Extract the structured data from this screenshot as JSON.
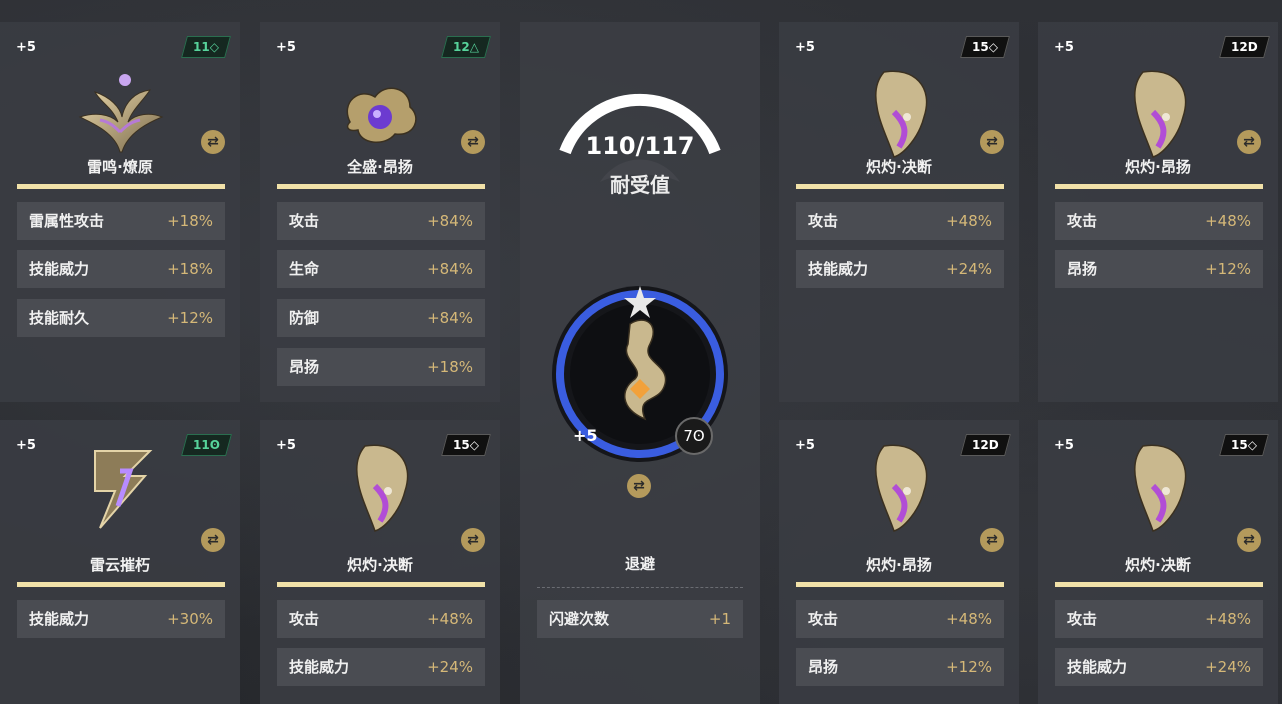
{
  "left_cards": [
    {
      "plus": "+5",
      "badge": "11◇",
      "badge_style": "green",
      "name": "雷鸣·燎原",
      "stats": [
        {
          "k": "雷属性攻击",
          "v": "+18%"
        },
        {
          "k": "技能威力",
          "v": "+18%"
        },
        {
          "k": "技能耐久",
          "v": "+12%"
        }
      ],
      "icon": "phoenix-emblem-icon"
    },
    {
      "plus": "+5",
      "badge": "12△",
      "badge_style": "green",
      "name": "全盛·昂扬",
      "stats": [
        {
          "k": "攻击",
          "v": "+84%"
        },
        {
          "k": "生命",
          "v": "+84%"
        },
        {
          "k": "防御",
          "v": "+84%"
        },
        {
          "k": "昂扬",
          "v": "+18%"
        }
      ],
      "icon": "serpent-orb-emblem-icon"
    },
    {
      "plus": "+5",
      "badge": "11ʘ",
      "badge_style": "green",
      "name": "雷云摧朽",
      "stats": [
        {
          "k": "技能威力",
          "v": "+30%"
        }
      ],
      "icon": "lightning-emblem-icon"
    },
    {
      "plus": "+5",
      "badge": "15◇",
      "badge_style": "black",
      "name": "炽灼·决断",
      "stats": [
        {
          "k": "攻击",
          "v": "+48%"
        },
        {
          "k": "技能威力",
          "v": "+24%"
        }
      ],
      "icon": "mask-emblem-icon"
    }
  ],
  "right_cards": [
    {
      "plus": "+5",
      "badge": "15◇",
      "badge_style": "black",
      "name": "炽灼·决断",
      "stats": [
        {
          "k": "攻击",
          "v": "+48%"
        },
        {
          "k": "技能威力",
          "v": "+24%"
        }
      ],
      "icon": "mask-emblem-icon"
    },
    {
      "plus": "+5",
      "badge": "12D",
      "badge_style": "black",
      "name": "炽灼·昂扬",
      "stats": [
        {
          "k": "攻击",
          "v": "+48%"
        },
        {
          "k": "昂扬",
          "v": "+12%"
        }
      ],
      "icon": "mask-emblem-icon"
    },
    {
      "plus": "+5",
      "badge": "12D",
      "badge_style": "black",
      "name": "炽灼·昂扬",
      "stats": [
        {
          "k": "攻击",
          "v": "+48%"
        },
        {
          "k": "昂扬",
          "v": "+12%"
        }
      ],
      "icon": "mask-emblem-icon"
    },
    {
      "plus": "+5",
      "badge": "15◇",
      "badge_style": "black",
      "name": "炽灼·决断",
      "stats": [
        {
          "k": "攻击",
          "v": "+48%"
        },
        {
          "k": "技能威力",
          "v": "+24%"
        }
      ],
      "icon": "mask-emblem-icon"
    }
  ],
  "center": {
    "durability": "110/117",
    "durability_fraction": 0.94,
    "durability_label": "耐受值",
    "plus": "+5",
    "count": "7ʘ",
    "name": "退避",
    "stats": [
      {
        "k": "闪避次数",
        "v": "+1"
      }
    ],
    "icon": "serpent-crest-icon"
  },
  "swap_glyph": "⇄",
  "colors": {
    "gold": "#b49a5c",
    "gold_bar": "#f1e1a8",
    "stat_value": "#d5b878",
    "accent_blue": "#3a5de0"
  }
}
